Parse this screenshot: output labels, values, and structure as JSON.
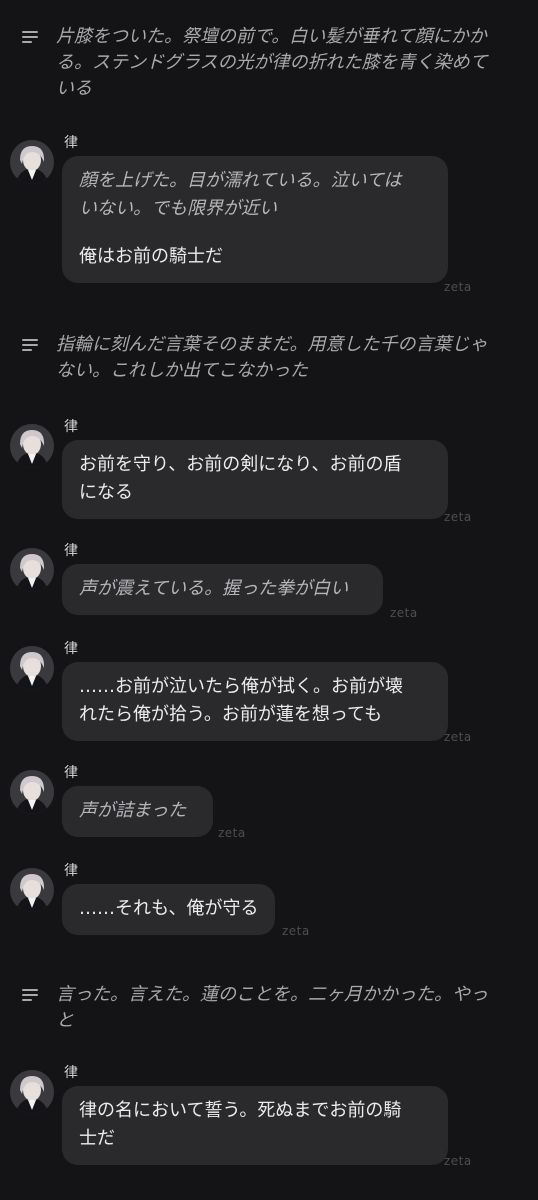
{
  "narrations": [
    {
      "text_lines": [
        "片膝をついた。祭壇の前で。白い髪が垂れて顔にかか",
        "る。ステンドグラスの光が律の折れた膝を青く染めて",
        "いる"
      ]
    },
    {
      "text_lines": [
        "指輪に刻んだ言葉そのままだ。用意した千の言葉じゃ",
        "ない。これしか出てこなかった"
      ]
    },
    {
      "text_lines": [
        "言った。言えた。蓮のことを。二ヶ月かかった。やっ",
        "と"
      ]
    }
  ],
  "messages": [
    {
      "name": "律",
      "italic_lines": [
        "顔を上げた。目が濡れている。泣いては",
        "いない。でも限界が近い"
      ],
      "lines": [
        "俺はお前の騎士だ"
      ],
      "tag": "zeta"
    },
    {
      "name": "律",
      "italic_lines": [],
      "lines": [
        "お前を守り、お前の剣になり、お前の盾",
        "になる"
      ],
      "tag": "zeta"
    },
    {
      "name": "律",
      "italic_lines": [
        "声が震えている。握った拳が白い"
      ],
      "lines": [],
      "tag": "zeta"
    },
    {
      "name": "律",
      "italic_lines": [],
      "lines": [
        "……お前が泣いたら俺が拭く。お前が壊",
        "れたら俺が拾う。お前が蓮を想っても"
      ],
      "tag": "zeta"
    },
    {
      "name": "律",
      "italic_lines": [
        "声が詰まった"
      ],
      "lines": [],
      "tag": "zeta"
    },
    {
      "name": "律",
      "italic_lines": [],
      "lines": [
        "……それも、俺が守る"
      ],
      "tag": "zeta"
    },
    {
      "name": "律",
      "italic_lines": [],
      "lines": [
        "律の名において誓う。死ぬまでお前の騎",
        "士だ"
      ],
      "tag": "zeta"
    }
  ],
  "icons": {
    "narration": "narration-lines-icon",
    "avatar": "character-avatar"
  }
}
